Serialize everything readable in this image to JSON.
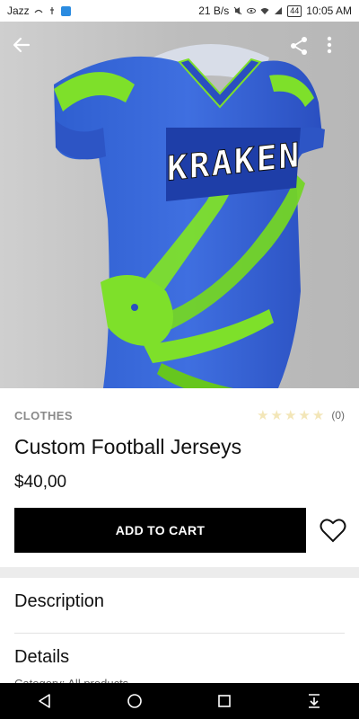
{
  "status_bar": {
    "carrier": "Jazz",
    "net_speed": "21 B/s",
    "battery": "44",
    "time": "10:05 AM"
  },
  "hero": {
    "alt": "KRAKEN",
    "jersey_text": "KRAKEN"
  },
  "toolbar": {
    "back_icon": "arrow-left-icon",
    "share_icon": "share-icon",
    "more_icon": "more-vert-icon"
  },
  "product": {
    "category": "CLOTHES",
    "rating_count": "(0)",
    "title": "Custom Football Jerseys",
    "price": "$40,00",
    "add_to_cart_label": "ADD TO CART"
  },
  "sections": {
    "description": "Description",
    "details": "Details",
    "details_preview": "Category:     All products"
  },
  "colors": {
    "accent": "#000000",
    "jersey_blue": "#2f55c8",
    "jersey_green": "#7ee02a",
    "star_empty": "#f3e6b8"
  }
}
